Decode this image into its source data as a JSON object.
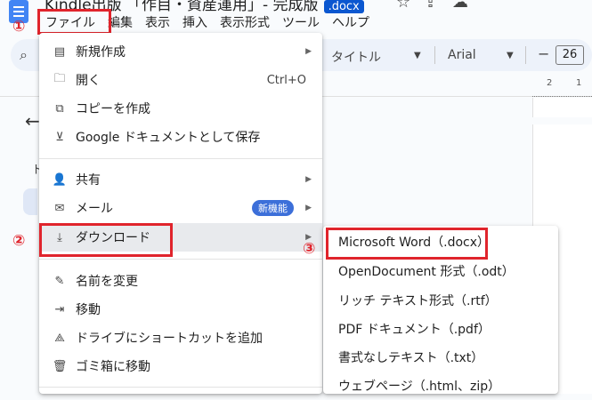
{
  "doc": {
    "title": "Kindle出版 「作目・資産運用」- 完成版",
    "ext_badge": ".docx"
  },
  "menubar": [
    "ファイル",
    "編集",
    "表示",
    "挿入",
    "表示形式",
    "ツール",
    "ヘルプ"
  ],
  "toolbar": {
    "style": "タイトル",
    "font": "Arial",
    "font_size": "26",
    "minus": "−"
  },
  "ruler": {
    "t1": "2",
    "t2": "1"
  },
  "annotations": {
    "n1": "①",
    "n2": "②",
    "n3": "③"
  },
  "colors": {
    "annotation": "#e0242c",
    "accent": "#0b57d0"
  },
  "file_menu": {
    "items": [
      {
        "icon": "doc-icon",
        "label": "新規作成",
        "arrow": "▶"
      },
      {
        "icon": "folder-icon",
        "label": "開く",
        "shortcut": "Ctrl+O"
      },
      {
        "icon": "copy-icon",
        "label": "コピーを作成"
      },
      {
        "icon": "save-icon",
        "label": "Google ドキュメントとして保存"
      },
      {
        "icon": "share-icon",
        "label": "共有",
        "arrow": "▶"
      },
      {
        "icon": "mail-icon",
        "label": "メール",
        "badge": "新機能",
        "arrow": "▶"
      },
      {
        "icon": "download-icon",
        "label": "ダウンロード",
        "arrow": "▶"
      },
      {
        "icon": "pencil-icon",
        "label": "名前を変更"
      },
      {
        "icon": "move-icon",
        "label": "移動"
      },
      {
        "icon": "drive-shortcut-icon",
        "label": "ドライブにショートカットを追加"
      },
      {
        "icon": "trash-icon",
        "label": "ゴミ箱に移動"
      }
    ]
  },
  "download_menu": {
    "items": [
      "Microsoft Word（.docx）",
      "OpenDocument 形式（.odt）",
      "リッチ テキスト形式（.rtf）",
      "PDF ドキュメント（.pdf）",
      "書式なしテキスト（.txt）",
      "ウェブページ（.html、zip）"
    ]
  }
}
